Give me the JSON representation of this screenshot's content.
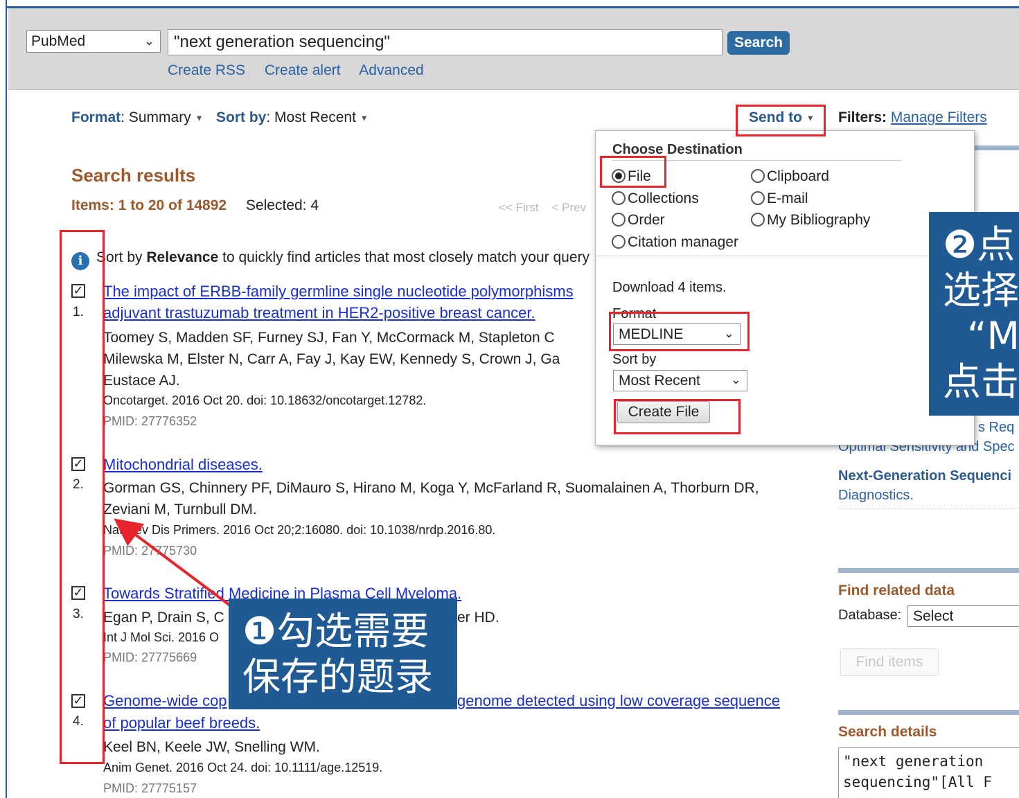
{
  "search": {
    "db": "PubMed",
    "term": "\"next generation sequencing\"",
    "button": "Search",
    "links": [
      "Create RSS",
      "Create alert",
      "Advanced"
    ]
  },
  "toolbar": {
    "format_label": "Format",
    "format_value": "Summary",
    "sort_label": "Sort by",
    "sort_value": "Most Recent",
    "send_to": "Send to",
    "filters_label": "Filters:",
    "manage_filters": "Manage Filters"
  },
  "results": {
    "title": "Search results",
    "items": "Items: 1 to 20 of 14892",
    "selected": "Selected: 4",
    "pager_first": "<< First",
    "pager_prev": "< Prev",
    "info_pre": "Sort by ",
    "info_bold": "Relevance",
    "info_post": " to quickly find articles that most closely match your query",
    "list": [
      {
        "num": "1.",
        "title_1": "The impact of ERBB-family germline single nucleotide polymorphisms",
        "title_2": "adjuvant trastuzumab treatment in HER2-positive breast cancer.",
        "auth_1": "Toomey S, Madden SF, Furney SJ, Fan Y, McCormack M, Stapleton C",
        "auth_2": "Milewska M, Elster N, Carr A, Fay J, Kay EW, Kennedy S, Crown J, Ga",
        "auth_3": "Eustace AJ.",
        "source": "Oncotarget. 2016 Oct 20. doi: 10.18632/oncotarget.12782.",
        "pmid": "PMID: 27776352"
      },
      {
        "num": "2.",
        "title_1": "Mitochondrial diseases.",
        "auth_1": "Gorman GS, Chinnery PF, DiMauro S, Hirano M, Koga Y, McFarland R, Suomalainen A, Thorburn DR,",
        "auth_2": "Zeviani M, Turnbull DM.",
        "source": "Nat Rev Dis Primers. 2016 Oct 20;2:16080. doi: 10.1038/nrdp.2016.80.",
        "pmid": "PMID: 27775730"
      },
      {
        "num": "3.",
        "title_1": "Towards Stratified Medicine in Plasma Cell Myeloma.",
        "auth_1": "Egan P, Drain S, C",
        "auth_1b": "er HD.",
        "source": "Int J Mol Sci. 2016 O",
        "pmid": "PMID: 27775669"
      },
      {
        "num": "4.",
        "title_1": "Genome-wide cop",
        "title_1b": "genome detected using low coverage sequence",
        "title_2": "of popular beef breeds.",
        "auth_1": "Keel BN, Keele JW, Snelling WM.",
        "source": "Anim Genet. 2016 Oct 24. doi: 10.1111/age.12519.",
        "pmid": "PMID: 27775157"
      }
    ]
  },
  "popup": {
    "heading": "Choose Destination",
    "options": [
      "File",
      "Clipboard",
      "Collections",
      "E-mail",
      "Order",
      "My Bibliography",
      "Citation manager"
    ],
    "download": "Download 4 items.",
    "format_label": "Format",
    "format_value": "MEDLINE",
    "sort_label": "Sort by",
    "sort_value": "Most Recent",
    "create_button": "Create File"
  },
  "sidebar": {
    "fragment_1": "s Req",
    "fragment_2": "Optimal Sensitivity and Spec",
    "ngs_title": "Next-Generation Sequenci",
    "ngs_sub": "Diagnostics.",
    "related_title": "Find related data",
    "database_label": "Database:",
    "database_value": "Select",
    "find_items": "Find items",
    "details_title": "Search details",
    "details_1": "\"next generation",
    "details_2": "sequencing\"[All F"
  },
  "callouts": {
    "one_1": "❶勾选需要",
    "one_2": "保存的题录",
    "two_1": "❷点",
    "two_2": "选择",
    "two_3": "  “M",
    "two_4": "点击"
  },
  "colors": {
    "annotation_red": "#e8242c",
    "callout_blue": "#1f5a94",
    "link_blue": "#1a2fcf",
    "heading_brown": "#9c5a2c"
  }
}
